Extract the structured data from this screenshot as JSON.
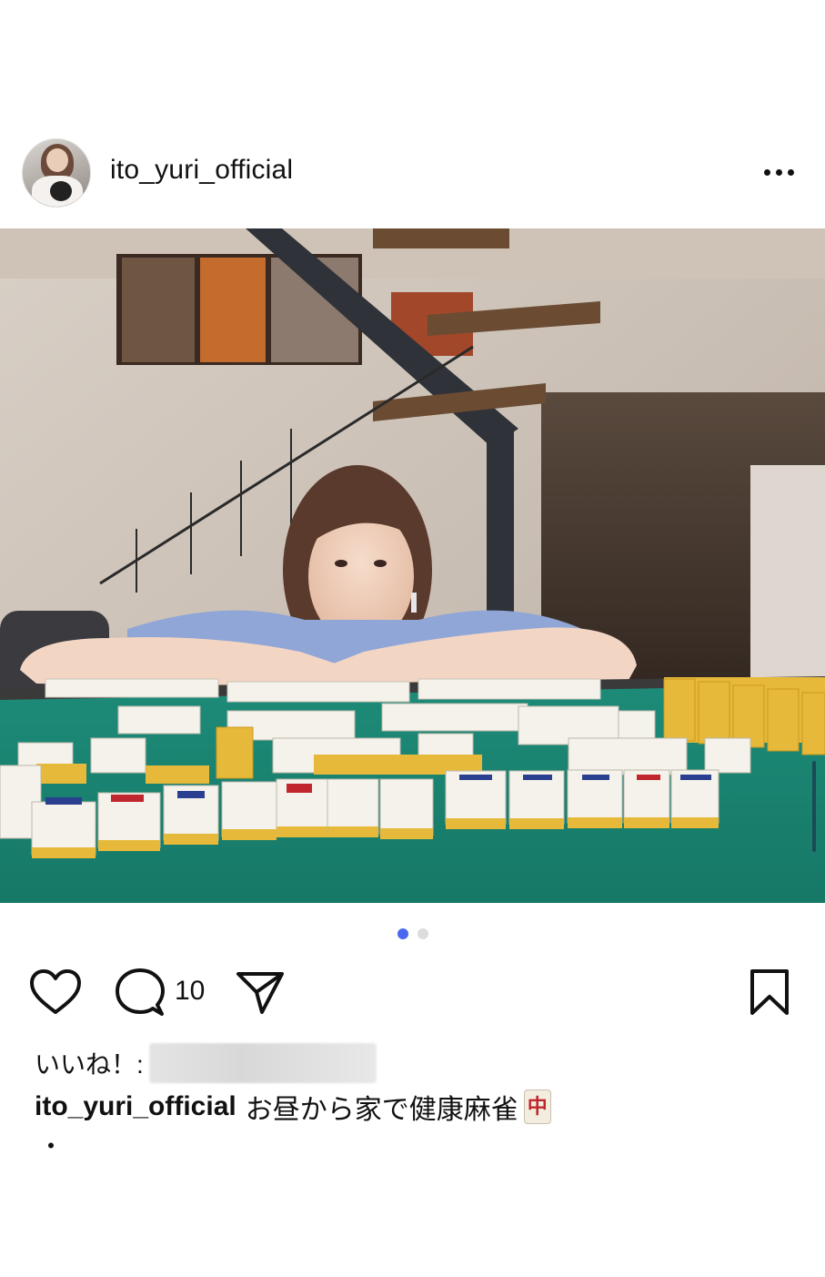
{
  "post": {
    "username": "ito_yuri_official",
    "photo_alt": "mahjong table photo",
    "carousel": {
      "active_index": 0,
      "count": 2,
      "active_color": "#4a67f0",
      "inactive_color": "#dcdcdc"
    },
    "comment_count": "10",
    "likes_label": "いいね！:",
    "caption_user": "ito_yuri_official",
    "caption_text": "お昼から家で健康麻雀",
    "caption_tile": "中",
    "caption_extra": "・"
  },
  "icons": {
    "more": "more-options-icon",
    "like": "heart-icon",
    "comment": "comment-icon",
    "share": "send-icon",
    "save": "bookmark-icon"
  },
  "colors": {
    "table_felt": "#1f8f7e",
    "tile_face": "#f4f2ea",
    "tile_back": "#e6b93a"
  }
}
